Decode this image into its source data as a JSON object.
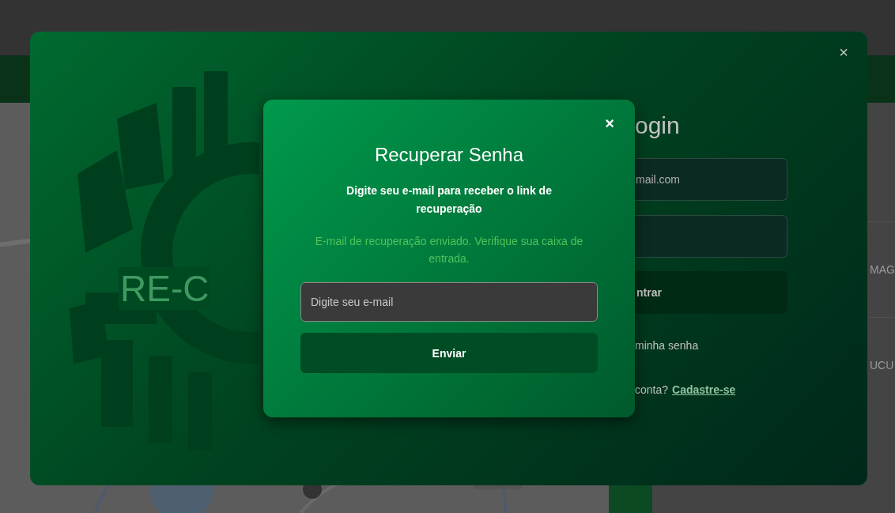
{
  "background": {
    "table_cells": [
      "MAG",
      "UCU"
    ]
  },
  "login_modal": {
    "close": "×",
    "logo_text": "RE-C",
    "title": "ogin",
    "fields": [
      {
        "kind": "text",
        "placeholder": "mail.com"
      },
      {
        "kind": "password"
      }
    ],
    "submit": "ntrar",
    "forgot_link": "minha senha",
    "signup_prompt": "conta?",
    "signup_link": "Cadastre-se"
  },
  "recovery_modal": {
    "close": "×",
    "title": "Recuperar Senha",
    "subtitle": "Digite seu e-mail para receber o link de recuperação",
    "message": "E-mail de recuperação enviado. Verifique sua caixa de entrada.",
    "email_field": {
      "placeholder": "Digite seu e-mail"
    },
    "submit": "Enviar"
  }
}
